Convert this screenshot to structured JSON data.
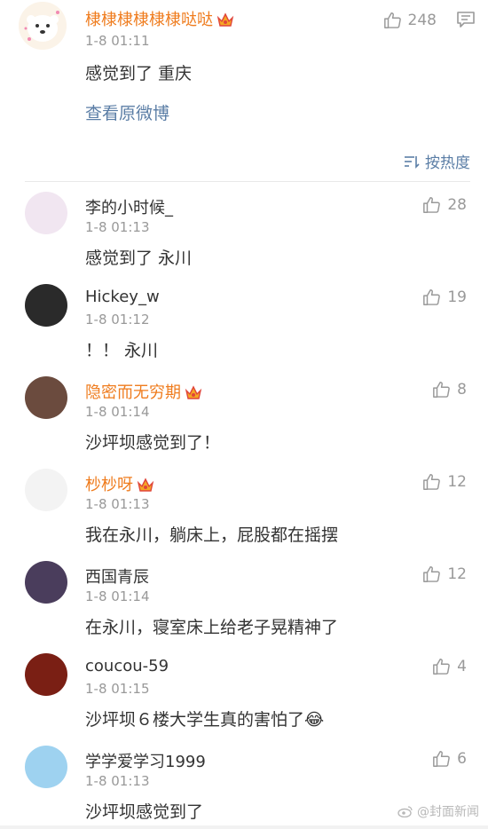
{
  "main_post": {
    "user": "棣棣棣棣棣棣哒哒",
    "time": "1-8 01:11",
    "text": "感觉到了 重庆",
    "likes": "248",
    "link": "查看原微博"
  },
  "sort_label": "按热度",
  "comments": [
    {
      "user": "李的小时候_",
      "vip": false,
      "time": "1-8 01:13",
      "text": "感觉到了 永川",
      "likes": "28",
      "avatar_color": "#f1e6f1"
    },
    {
      "user": "Hickey_w",
      "vip": false,
      "time": "1-8 01:12",
      "text": "！！ 永川",
      "likes": "19",
      "avatar_color": "#2a2a2a"
    },
    {
      "user": "隐密而无穷期",
      "vip": true,
      "time": "1-8 01:14",
      "text": "沙坪坝感觉到了！",
      "likes": "8",
      "avatar_color": "#6b4b3e"
    },
    {
      "user": "杪杪呀",
      "vip": true,
      "time": "1-8 01:13",
      "text": "我在永川，躺床上，屁股都在摇摆",
      "likes": "12",
      "avatar_color": "#f3f3f3"
    },
    {
      "user": "西国青辰",
      "vip": false,
      "time": "1-8 01:14",
      "text": "在永川，寝室床上给老子晃精神了",
      "likes": "12",
      "avatar_color": "#4a3d5c"
    },
    {
      "user": "coucou-59",
      "vip": false,
      "time": "1-8 01:15",
      "text": "沙坪坝６楼大学生真的害怕了😂",
      "likes": "4",
      "avatar_color": "#7a1f14"
    },
    {
      "user": "学学爱学习1999",
      "vip": false,
      "time": "1-8 01:13",
      "text": "沙坪坝感觉到了",
      "likes": "6",
      "avatar_color": "#9ed2f0"
    }
  ],
  "watermark": "@封面新闻",
  "colors": {
    "vip_name": "#ef7c1e",
    "link": "#5b7ea6",
    "meta": "#999999"
  },
  "icons": {
    "like": "thumbs-up-icon",
    "menu": "comment-menu-icon",
    "sort": "sort-icon",
    "vip": "vip-crown-icon",
    "watermark": "weibo-icon"
  }
}
